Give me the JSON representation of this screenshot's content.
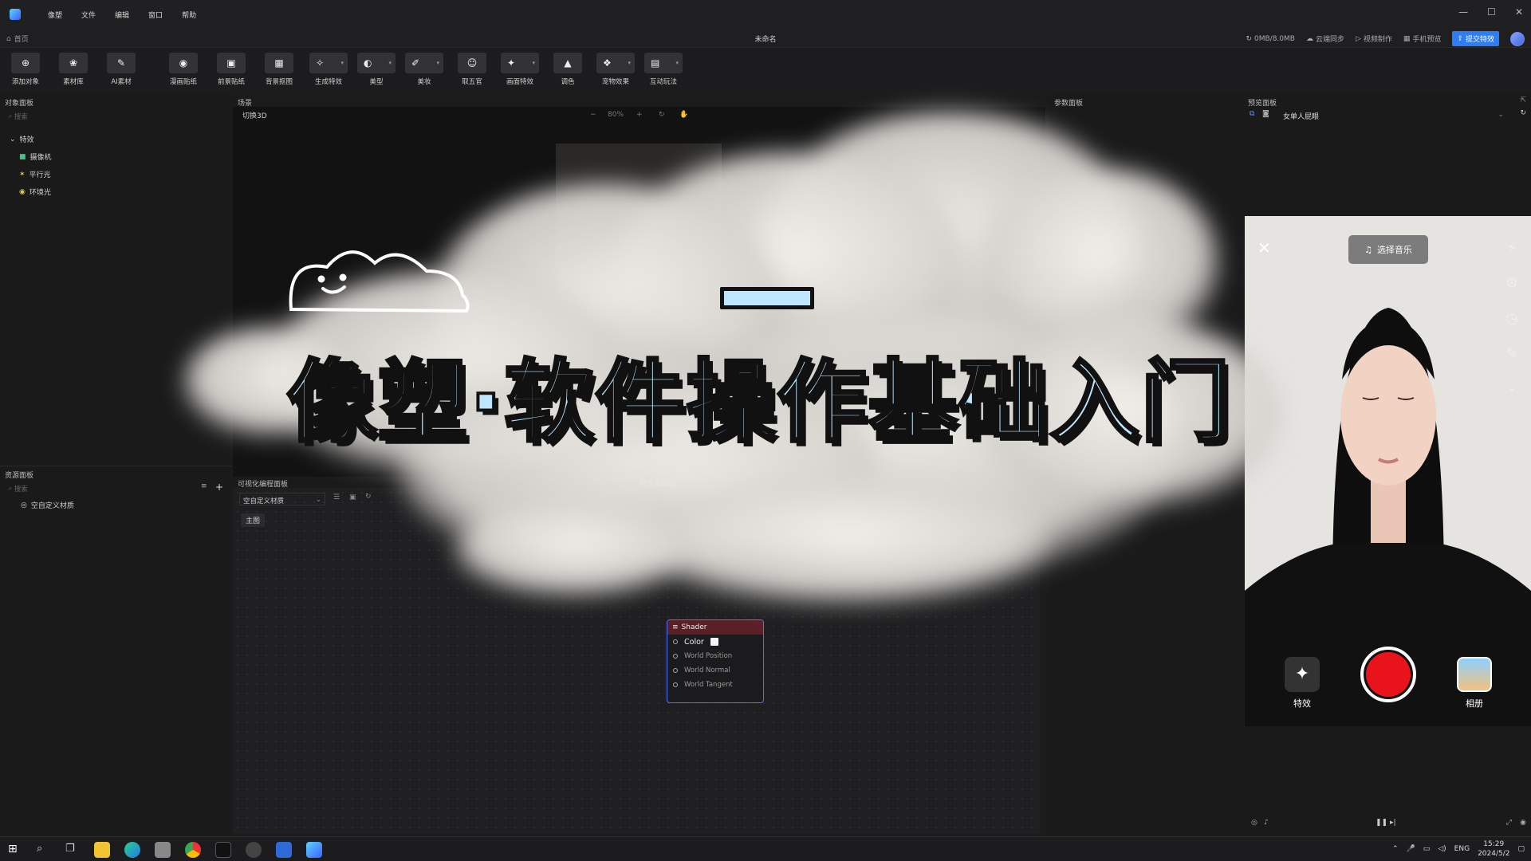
{
  "menubar": {
    "app_name": "像塑",
    "items": [
      "文件",
      "编辑",
      "窗口",
      "帮助"
    ],
    "window_controls": [
      "—",
      "☐",
      "✕"
    ]
  },
  "subbar": {
    "home": "首页",
    "doc_title": "未命名",
    "memory": "0MB/8.0MB",
    "cloud": "云端同步",
    "record": "视频制作",
    "phone": "手机预览",
    "submit": "提交特效"
  },
  "toolbar": [
    {
      "label": "添加对象",
      "icon": "plus-icon",
      "glyph": "⊕"
    },
    {
      "label": "素材库",
      "icon": "material-library-icon",
      "glyph": "❀"
    },
    {
      "label": "AI素材",
      "icon": "ai-material-icon",
      "glyph": "✎"
    },
    {
      "label": "漫画贴纸",
      "icon": "comic-sticker-icon",
      "glyph": "◉"
    },
    {
      "label": "前景贴纸",
      "icon": "foreground-sticker-icon",
      "glyph": "▣"
    },
    {
      "label": "背景抠图",
      "icon": "background-matting-icon",
      "glyph": "▦"
    },
    {
      "label": "生成特效",
      "icon": "generate-effect-icon",
      "glyph": "✧"
    },
    {
      "label": "美型",
      "icon": "face-shape-icon",
      "glyph": "◐"
    },
    {
      "label": "美妆",
      "icon": "makeup-icon",
      "glyph": "✐"
    },
    {
      "label": "取五官",
      "icon": "facial-features-icon",
      "glyph": "☺"
    },
    {
      "label": "画面特效",
      "icon": "screen-effect-icon",
      "glyph": "✦"
    },
    {
      "label": "调色",
      "icon": "color-grade-icon",
      "glyph": "▲"
    },
    {
      "label": "宠物效果",
      "icon": "pet-effect-icon",
      "glyph": "❖"
    },
    {
      "label": "互动玩法",
      "icon": "interactive-icon",
      "glyph": "▤"
    }
  ],
  "object_panel": {
    "title": "对象面板",
    "search": "搜索",
    "group": "特效",
    "items": [
      "摄像机",
      "平行光",
      "环境光"
    ]
  },
  "scene_panel": {
    "title": "场景",
    "toggle_3d": "切换3D",
    "zoom": "80%"
  },
  "params_panel": {
    "title": "参数面板"
  },
  "resource_panel": {
    "title": "资源面板",
    "search": "搜索",
    "items": [
      "空自定义材质"
    ]
  },
  "graph_panel": {
    "title": "可视化编程面板",
    "material_title": "材质编辑器",
    "material_select": "空自定义材质",
    "tab": "主图"
  },
  "shader_node": {
    "title": "Shader",
    "ports": [
      "Color",
      "World Position",
      "World Normal",
      "World Tangent"
    ]
  },
  "preview_panel": {
    "title": "预览面板",
    "model": "女单人屁眼",
    "music": "选择音乐",
    "effects": "特效",
    "album": "相册"
  },
  "overlay": {
    "title": "像塑·软件操作基础入门",
    "dash": "一"
  },
  "taskbar": {
    "lang": "ENG",
    "time": "15:29",
    "date": "2024/5/2"
  },
  "colors": {
    "accent": "#2d7df6",
    "record": "#e8131b",
    "title_fill": "#bfe6ff",
    "node_header": "#5a1f27"
  }
}
